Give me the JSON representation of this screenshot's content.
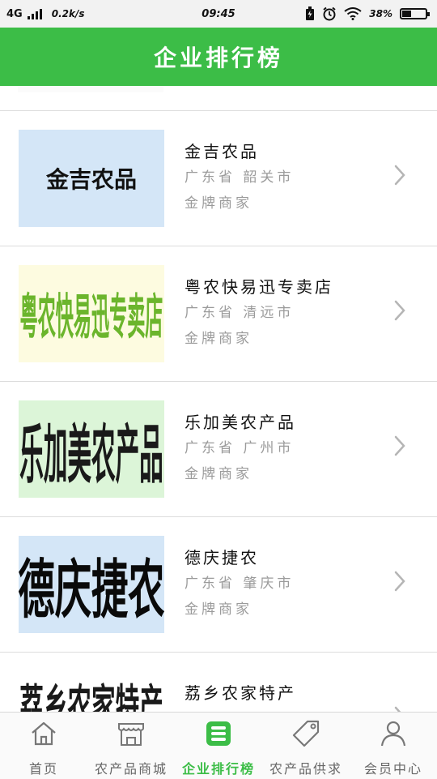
{
  "status_bar": {
    "network": "4G",
    "speed": "0.2k/s",
    "time": "09:45",
    "battery_percent": 38
  },
  "header": {
    "title": "企业排行榜"
  },
  "companies": [
    {
      "logo_text": "金吉农品",
      "logo_bg": "#d4e6f7",
      "logo_color": "#111111",
      "name": "金吉农品",
      "location": "广东省 韶关市",
      "level": "金牌商家"
    },
    {
      "logo_text": "粤农快易迅专卖店",
      "logo_bg": "#fdfbe0",
      "logo_color": "#6bb52c",
      "name": "粤农快易迅专卖店",
      "location": "广东省 清远市",
      "level": "金牌商家"
    },
    {
      "logo_text": "乐加美农产品",
      "logo_bg": "#dcf5d8",
      "logo_color": "#1a1a1a",
      "name": "乐加美农产品",
      "location": "广东省 广州市",
      "level": "金牌商家"
    },
    {
      "logo_text": "德庆捷农",
      "logo_bg": "#d4e6f7",
      "logo_color": "#0a0a0a",
      "name": "德庆捷农",
      "location": "广东省 肇庆市",
      "level": "金牌商家"
    },
    {
      "logo_text": "荔乡农家特产",
      "logo_bg": "#ffffff",
      "logo_color": "#1a1a1a",
      "name": "荔乡农家特产",
      "location": "",
      "level": ""
    }
  ],
  "tabbar": {
    "accent_color": "#3cbd47",
    "tabs": [
      {
        "label": "首页",
        "icon": "home-icon",
        "active": false
      },
      {
        "label": "农产品商城",
        "icon": "shop-icon",
        "active": false
      },
      {
        "label": "企业排行榜",
        "icon": "ranking-list-icon",
        "active": true
      },
      {
        "label": "农产品供求",
        "icon": "tag-icon",
        "active": false
      },
      {
        "label": "会员中心",
        "icon": "user-icon",
        "active": false
      }
    ]
  }
}
